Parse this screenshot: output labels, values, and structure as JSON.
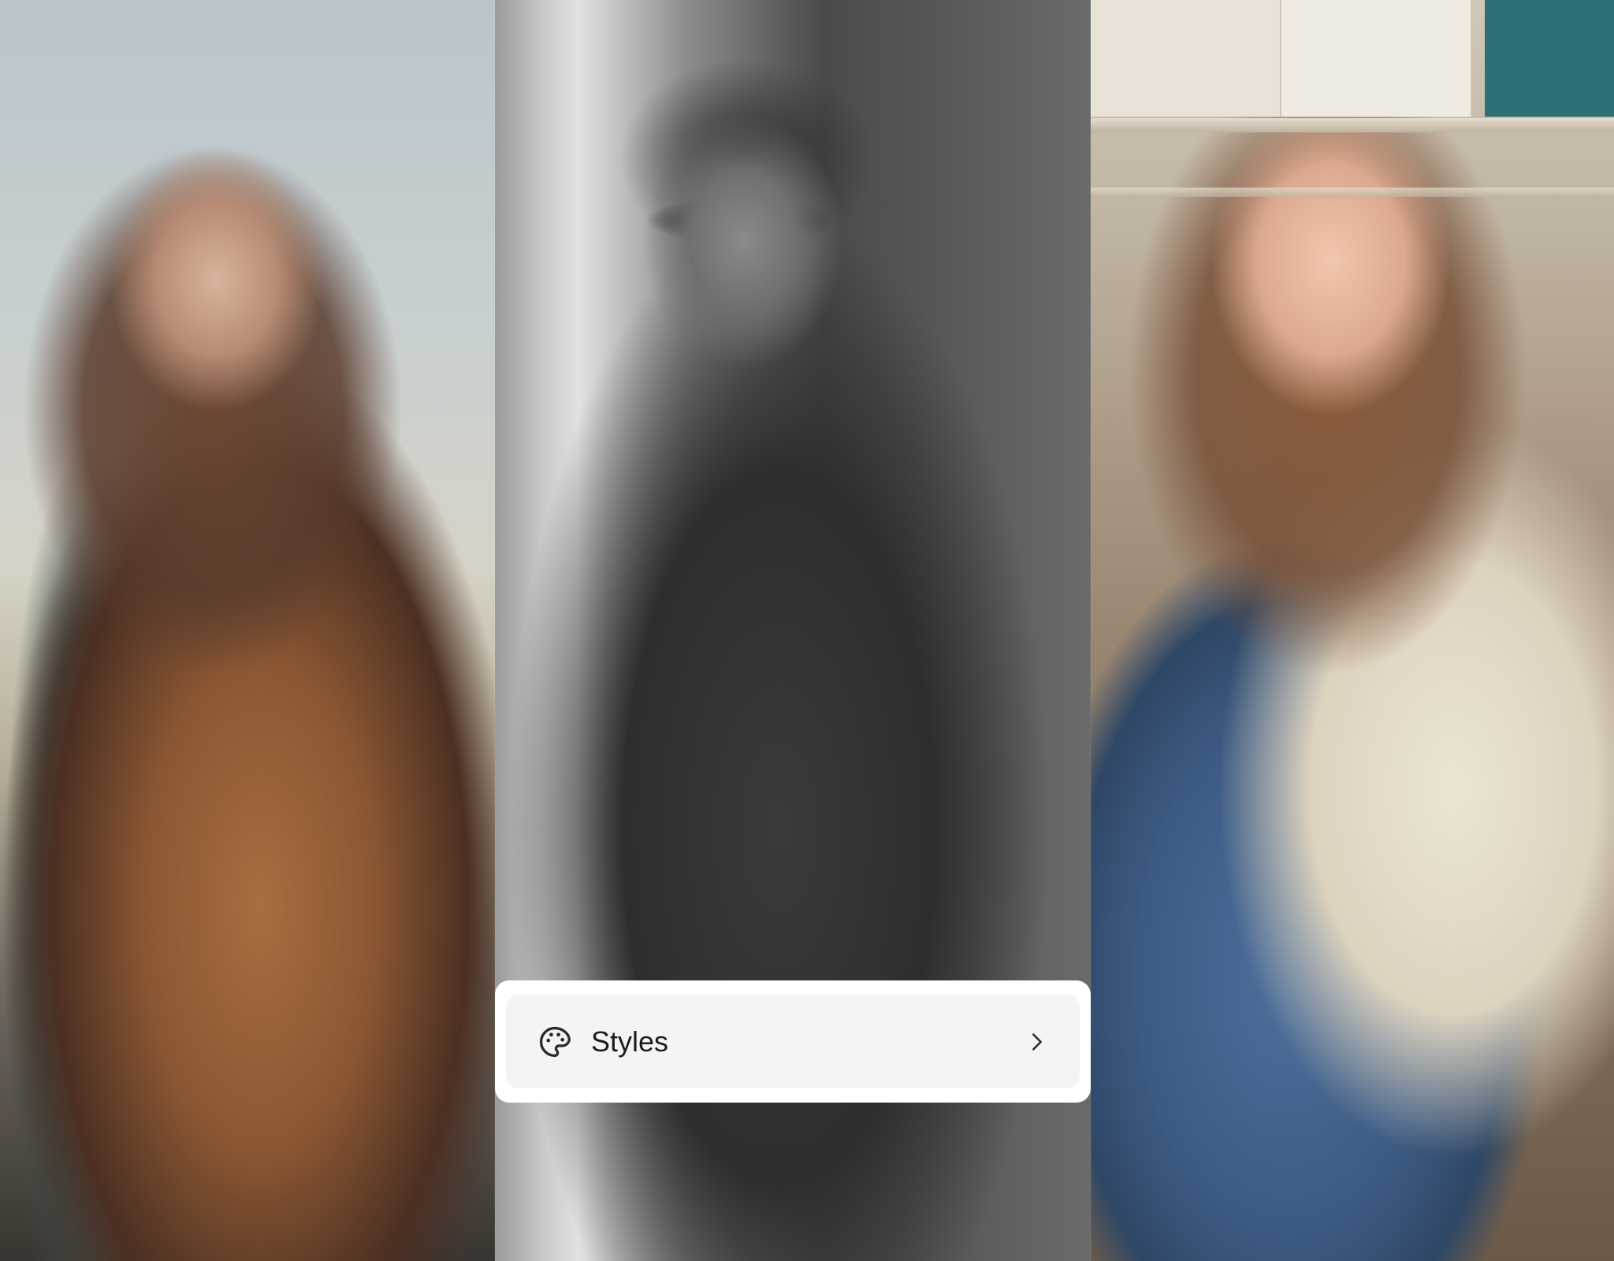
{
  "styles_menu": {
    "label": "Styles",
    "icon": "palette-icon",
    "trailing_icon": "chevron-right-icon"
  },
  "colors": {
    "card_background": "#ffffff",
    "row_background": "#f4f4f4",
    "text": "#1c1c1c"
  }
}
